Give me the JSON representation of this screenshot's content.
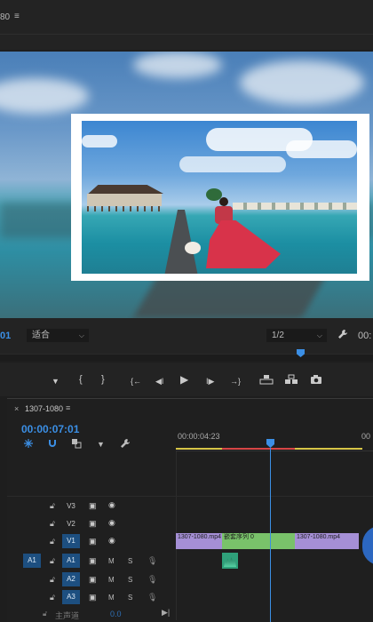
{
  "top": {
    "title": "80",
    "menu_icon": "≡"
  },
  "program_monitor": {
    "timecode": "01",
    "fit": {
      "value": "适合"
    },
    "resolution": {
      "value": "1/2"
    },
    "settings_icon": "wrench-icon",
    "timecode_right": "00:"
  },
  "transport": {
    "add_marker": "▼",
    "mark_in": "{",
    "mark_out": "}",
    "go_to_in": "{←",
    "step_back": "◀I",
    "play": "▶",
    "step_forward": "I▶",
    "go_to_out": "→}",
    "lift": "lift-icon",
    "extract": "extract-icon",
    "export_frame": "camera-icon"
  },
  "timeline": {
    "close": "×",
    "sequence_name": "1307-1080",
    "menu": "≡",
    "timecode": "00:00:07:01",
    "ruler_tc": "00:00:04:23",
    "ruler_tc_end": "00",
    "tools": [
      "snap-icon",
      "magnet-icon",
      "linked-selection-icon",
      "marker-icon",
      "wrench-icon"
    ],
    "video_tracks": [
      {
        "name": "V3",
        "active": false
      },
      {
        "name": "V2",
        "active": false
      },
      {
        "name": "V1",
        "active": true
      }
    ],
    "audio_tracks": [
      {
        "name": "A1",
        "source": "A1",
        "m": "M",
        "s": "S"
      },
      {
        "name": "A2",
        "source": "",
        "m": "M",
        "s": "S"
      },
      {
        "name": "A3",
        "source": "",
        "m": "M",
        "s": "S"
      }
    ],
    "master": {
      "label": "主声道",
      "value": "0.0"
    },
    "clips": {
      "v1_a": "1307-1080.mp4",
      "v1_b": "嵌套序列 0",
      "v1_c": "1307-1080.mp4",
      "colors": {
        "purple": "#a58fd6",
        "green": "#79c26a",
        "audio": "#2fa07a"
      }
    }
  },
  "colors": {
    "accent": "#3b8fe5",
    "work_area": "#d6c547",
    "render_red": "#d64545"
  }
}
